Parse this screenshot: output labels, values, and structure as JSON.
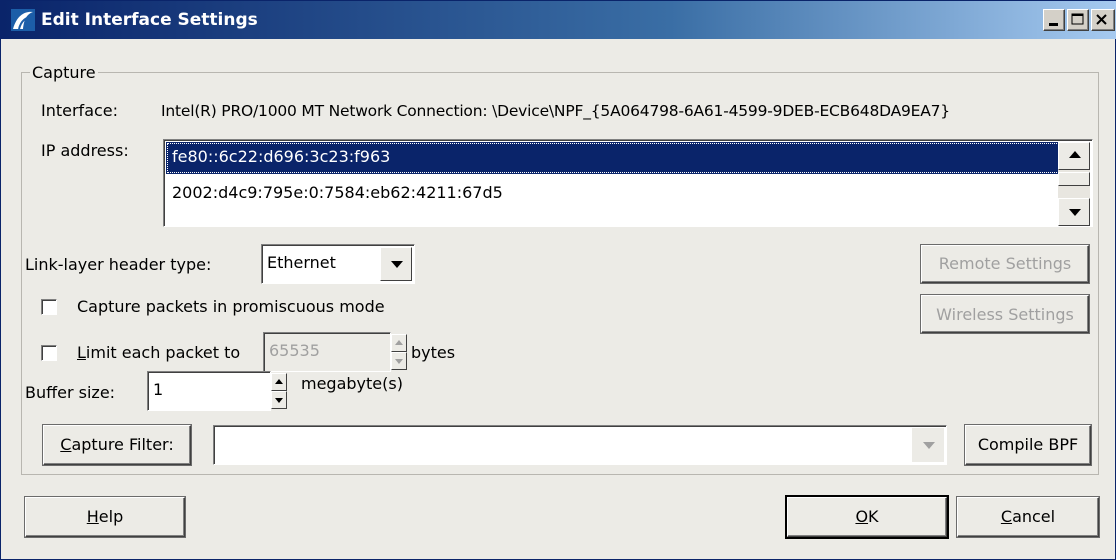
{
  "window": {
    "title": "Edit Interface Settings"
  },
  "capture": {
    "legend": "Capture",
    "interface_label": "Interface:",
    "interface_value": "Intel(R) PRO/1000 MT Network Connection: \\Device\\NPF_{5A064798-6A61-4599-9DEB-ECB648DA9EA7}",
    "ip_label": "IP address:",
    "ip_addresses": [
      "fe80::6c22:d696:3c23:f963",
      "2002:d4c9:795e:0:7584:eb62:4211:67d5"
    ],
    "link_layer_label": "Link-layer header type:",
    "link_layer_value": "Ethernet",
    "remote_settings_label": "Remote Settings",
    "wireless_settings_label": "Wireless Settings",
    "promiscuous_label": "Capture packets in promiscuous mode",
    "promiscuous_checked": false,
    "limit_label_accel": "L",
    "limit_label_rest": "imit each packet to",
    "limit_checked": false,
    "limit_value": "65535",
    "limit_unit": "bytes",
    "buffer_label": "Buffer size:",
    "buffer_value": "1",
    "buffer_unit": "megabyte(s)",
    "capture_filter_accel": "C",
    "capture_filter_rest": "apture Filter:",
    "capture_filter_value": "",
    "compile_bpf_label": "Compile BPF"
  },
  "footer": {
    "help_accel": "H",
    "help_rest": "elp",
    "ok_accel": "O",
    "ok_rest": "K",
    "cancel_accel": "C",
    "cancel_rest": "ancel"
  },
  "colors": {
    "title_gradient_start": "#0a246a",
    "title_gradient_end": "#a6caf0",
    "selection": "#0a246a",
    "dialog_bg": "#ecebe6",
    "disabled_text": "#a0a0a0"
  },
  "icons": [
    "wireshark-fin-icon",
    "minimize-icon",
    "maximize-icon",
    "close-icon",
    "scroll-up-icon",
    "scroll-down-icon",
    "dropdown-arrow-icon",
    "spin-up-icon",
    "spin-down-icon"
  ]
}
